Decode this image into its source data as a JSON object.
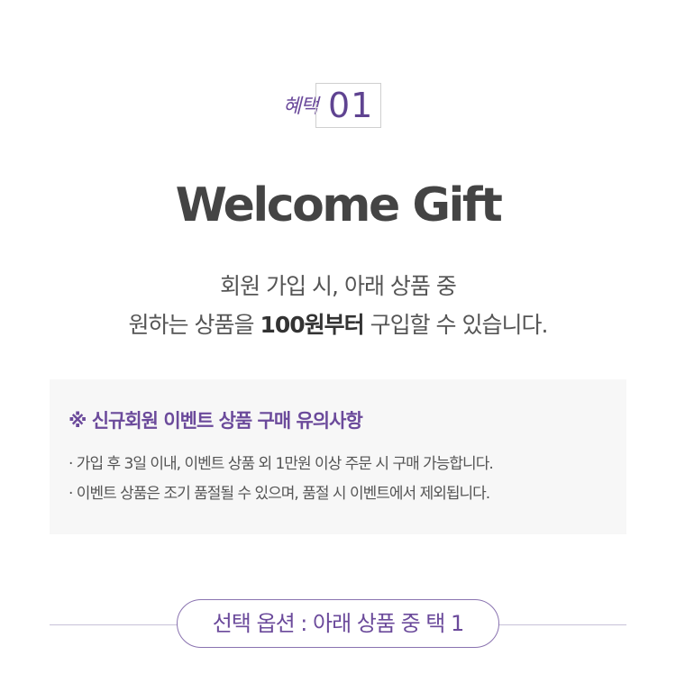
{
  "badge": {
    "script_label": "혜택",
    "number": "01"
  },
  "title": "Welcome Gift",
  "description": {
    "line1": "회원 가입 시, 아래 상품 중",
    "line2_pre": "원하는 상품을 ",
    "line2_bold": "100원부터",
    "line2_post": " 구입할 수 있습니다."
  },
  "notice": {
    "heading": "※ 신규회원 이벤트 상품 구매 유의사항",
    "items": [
      "· 가입 후 3일 이내, 이벤트 상품 외 1만원 이상 주문 시 구매 가능합니다.",
      "· 이벤트 상품은 조기 품절될 수 있으며, 품절 시 이벤트에서 제외됩니다."
    ]
  },
  "option": {
    "label": "선택 옵션 : 아래 상품 중 택 1"
  },
  "colors": {
    "accent": "#6b4a9b",
    "panel_bg": "#f7f7f7",
    "text": "#555555"
  }
}
